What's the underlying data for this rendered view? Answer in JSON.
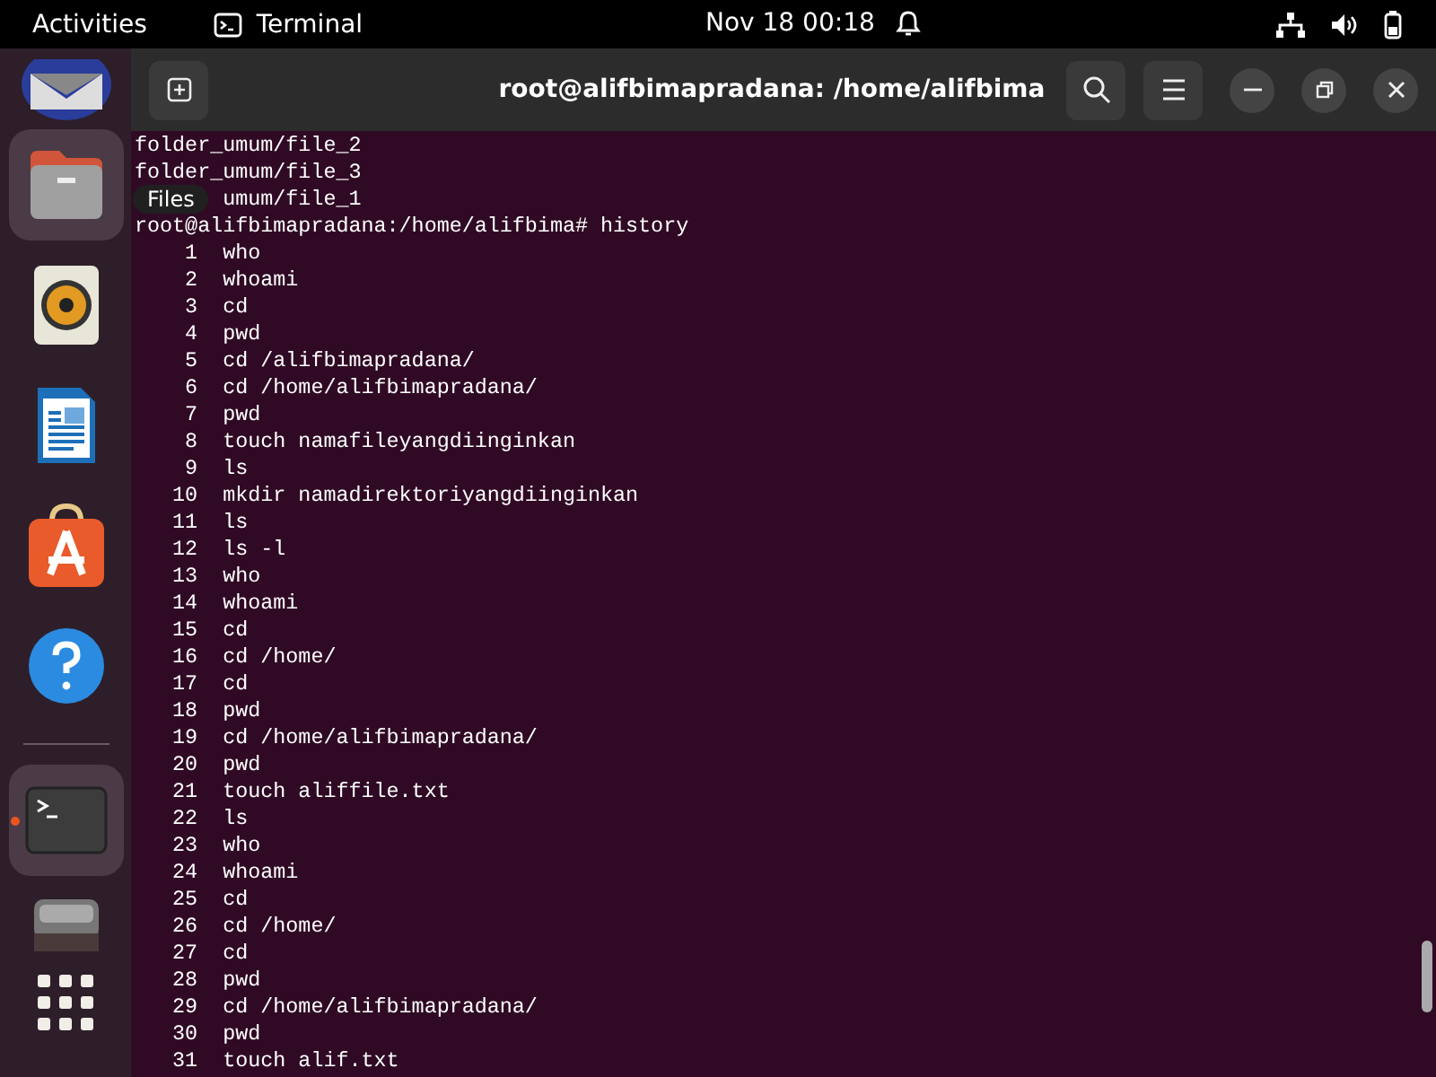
{
  "top_bar": {
    "activities": "Activities",
    "app_name": "Terminal",
    "clock": "Nov 18  00:18"
  },
  "dock": [
    {
      "kind": "mail",
      "selected": false,
      "running": false
    },
    {
      "kind": "files",
      "selected": true,
      "running": false
    },
    {
      "kind": "music",
      "selected": false,
      "running": false
    },
    {
      "kind": "writer",
      "selected": false,
      "running": false
    },
    {
      "kind": "store",
      "selected": false,
      "running": false
    },
    {
      "kind": "help",
      "selected": false,
      "running": false
    },
    {
      "kind": "terminal",
      "selected": true,
      "running": true
    },
    {
      "kind": "drive",
      "selected": false,
      "running": false
    },
    {
      "kind": "apps",
      "selected": false,
      "running": false
    }
  ],
  "tooltip": "Files",
  "window": {
    "title": "root@alifbimapradana: /home/alifbima"
  },
  "terminal": {
    "lines": [
      {
        "kind": "plain",
        "text": "folder_umum/file_2"
      },
      {
        "kind": "plain",
        "text": "folder_umum/file_3"
      },
      {
        "kind": "covered",
        "text": "umum/file_1"
      },
      {
        "kind": "plain",
        "text": "root@alifbimapradana:/home/alifbima# history"
      },
      {
        "kind": "plain",
        "text": "    1  who"
      },
      {
        "kind": "plain",
        "text": "    2  whoami"
      },
      {
        "kind": "plain",
        "text": "    3  cd"
      },
      {
        "kind": "plain",
        "text": "    4  pwd"
      },
      {
        "kind": "plain",
        "text": "    5  cd /alifbimapradana/"
      },
      {
        "kind": "plain",
        "text": "    6  cd /home/alifbimapradana/"
      },
      {
        "kind": "plain",
        "text": "    7  pwd"
      },
      {
        "kind": "plain",
        "text": "    8  touch namafileyangdiinginkan"
      },
      {
        "kind": "plain",
        "text": "    9  ls"
      },
      {
        "kind": "plain",
        "text": "   10  mkdir namadirektoriyangdiinginkan"
      },
      {
        "kind": "plain",
        "text": "   11  ls"
      },
      {
        "kind": "plain",
        "text": "   12  ls -l"
      },
      {
        "kind": "plain",
        "text": "   13  who"
      },
      {
        "kind": "plain",
        "text": "   14  whoami"
      },
      {
        "kind": "plain",
        "text": "   15  cd"
      },
      {
        "kind": "plain",
        "text": "   16  cd /home/"
      },
      {
        "kind": "plain",
        "text": "   17  cd"
      },
      {
        "kind": "plain",
        "text": "   18  pwd"
      },
      {
        "kind": "plain",
        "text": "   19  cd /home/alifbimapradana/"
      },
      {
        "kind": "plain",
        "text": "   20  pwd"
      },
      {
        "kind": "plain",
        "text": "   21  touch aliffile.txt"
      },
      {
        "kind": "plain",
        "text": "   22  ls"
      },
      {
        "kind": "plain",
        "text": "   23  who"
      },
      {
        "kind": "plain",
        "text": "   24  whoami"
      },
      {
        "kind": "plain",
        "text": "   25  cd"
      },
      {
        "kind": "plain",
        "text": "   26  cd /home/"
      },
      {
        "kind": "plain",
        "text": "   27  cd"
      },
      {
        "kind": "plain",
        "text": "   28  pwd"
      },
      {
        "kind": "plain",
        "text": "   29  cd /home/alifbimapradana/"
      },
      {
        "kind": "plain",
        "text": "   30  pwd"
      },
      {
        "kind": "plain",
        "text": "   31  touch alif.txt"
      }
    ]
  }
}
